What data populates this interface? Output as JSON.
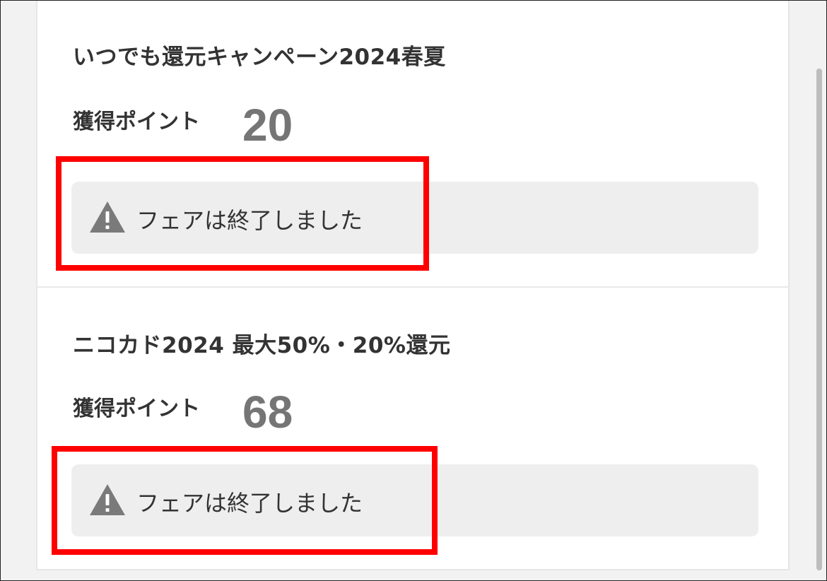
{
  "campaigns": [
    {
      "title": "いつでも還元キャンペーン2024春夏",
      "points_label": "獲得ポイント",
      "points_value": "20",
      "notice": {
        "icon": "warning-icon",
        "text": "フェアは終了しました"
      }
    },
    {
      "title": "ニコカド2024 最大50%・20%還元",
      "points_label": "獲得ポイント",
      "points_value": "68",
      "notice": {
        "icon": "warning-icon",
        "text": "フェアは終了しました"
      }
    }
  ],
  "colors": {
    "accent_highlight": "#ff0000",
    "notice_background": "#eeeeee",
    "points_value": "#757575",
    "text": "#333333"
  }
}
